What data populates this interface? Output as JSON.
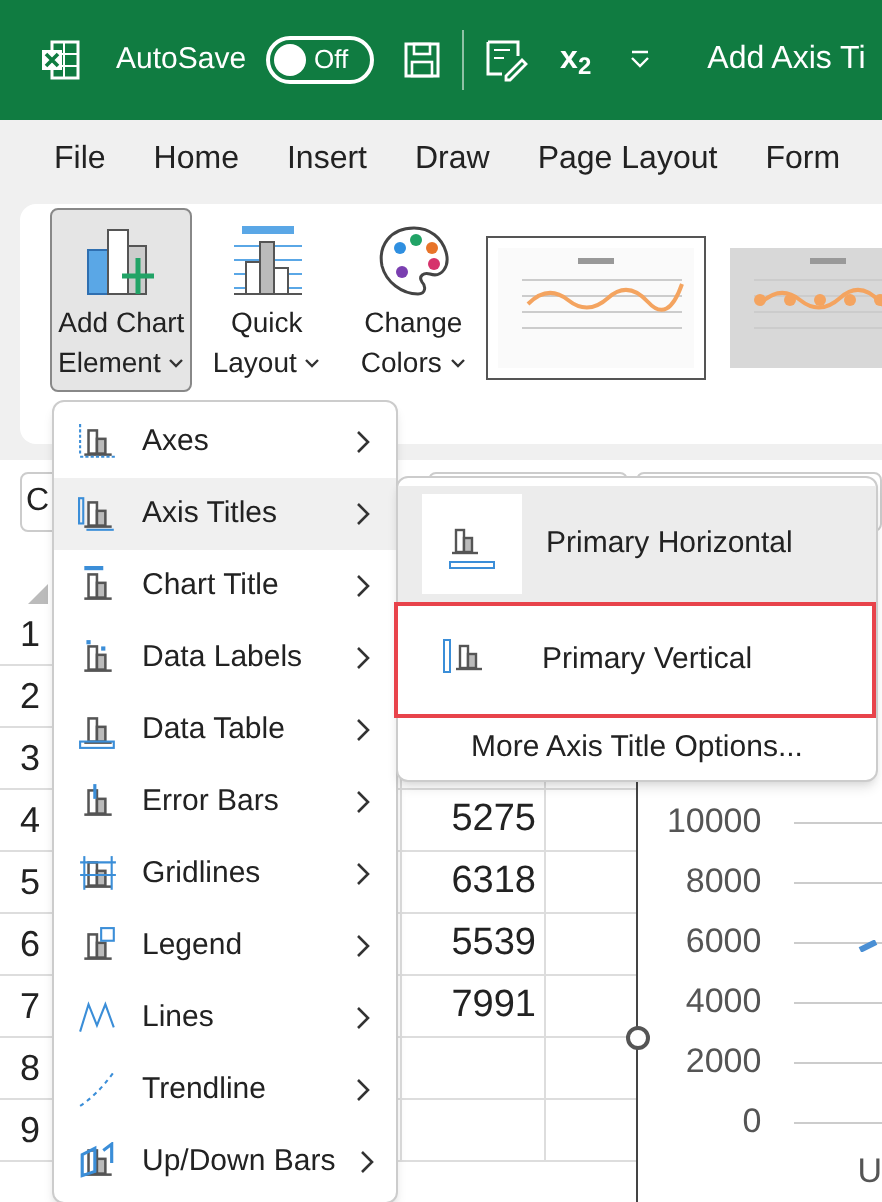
{
  "title_bar": {
    "autosave_label": "AutoSave",
    "autosave": {
      "on": false,
      "label": "Off"
    },
    "subscript_button": "x$_{2}$",
    "document_title": "Add Axis Ti"
  },
  "menu_tabs": [
    {
      "label": "File"
    },
    {
      "label": "Home"
    },
    {
      "label": "Insert"
    },
    {
      "label": "Draw"
    },
    {
      "label": "Page Layout"
    },
    {
      "label": "Form"
    }
  ],
  "ribbon": {
    "buttons": [
      {
        "lines": [
          "Add Chart",
          "Element"
        ],
        "selected": true
      },
      {
        "lines": [
          "Quick",
          "Layout"
        ],
        "selected": false
      },
      {
        "lines": [
          "Change",
          "Colors"
        ],
        "selected": false
      }
    ],
    "chart_styles": [
      {
        "selected": true
      },
      {
        "selected": false
      }
    ]
  },
  "name_box": "C",
  "sheet": {
    "rows": [
      {
        "header": "1"
      },
      {
        "header": "2"
      },
      {
        "header": "3"
      },
      {
        "header": "4",
        "value": "5275"
      },
      {
        "header": "5",
        "value": "6318"
      },
      {
        "header": "6",
        "value": "5539"
      },
      {
        "header": "7",
        "value": "7991"
      },
      {
        "header": "8"
      },
      {
        "header": "9"
      }
    ]
  },
  "chart": {
    "axis_labels": [
      "10000",
      "8000",
      "6000",
      "4000",
      "2000",
      "0"
    ],
    "category_label": "U"
  },
  "dropdown": {
    "items": [
      {
        "label": "Axes",
        "highlighted": false
      },
      {
        "label": "Axis Titles",
        "highlighted": true
      },
      {
        "label": "Chart Title",
        "highlighted": false
      },
      {
        "label": "Data Labels",
        "highlighted": false
      },
      {
        "label": "Data Table",
        "highlighted": false
      },
      {
        "label": "Error Bars",
        "highlighted": false
      },
      {
        "label": "Gridlines",
        "highlighted": false
      },
      {
        "label": "Legend",
        "highlighted": false
      },
      {
        "label": "Lines",
        "highlighted": false
      },
      {
        "label": "Trendline",
        "highlighted": false
      },
      {
        "label": "Up/Down Bars",
        "highlighted": false
      }
    ]
  },
  "submenu": {
    "items": [
      {
        "label": "Primary Horizontal",
        "highlighted": true,
        "outlined": false
      },
      {
        "label": "Primary Vertical",
        "highlighted": false,
        "outlined": true
      }
    ],
    "more_link": "More Axis Title Options..."
  }
}
